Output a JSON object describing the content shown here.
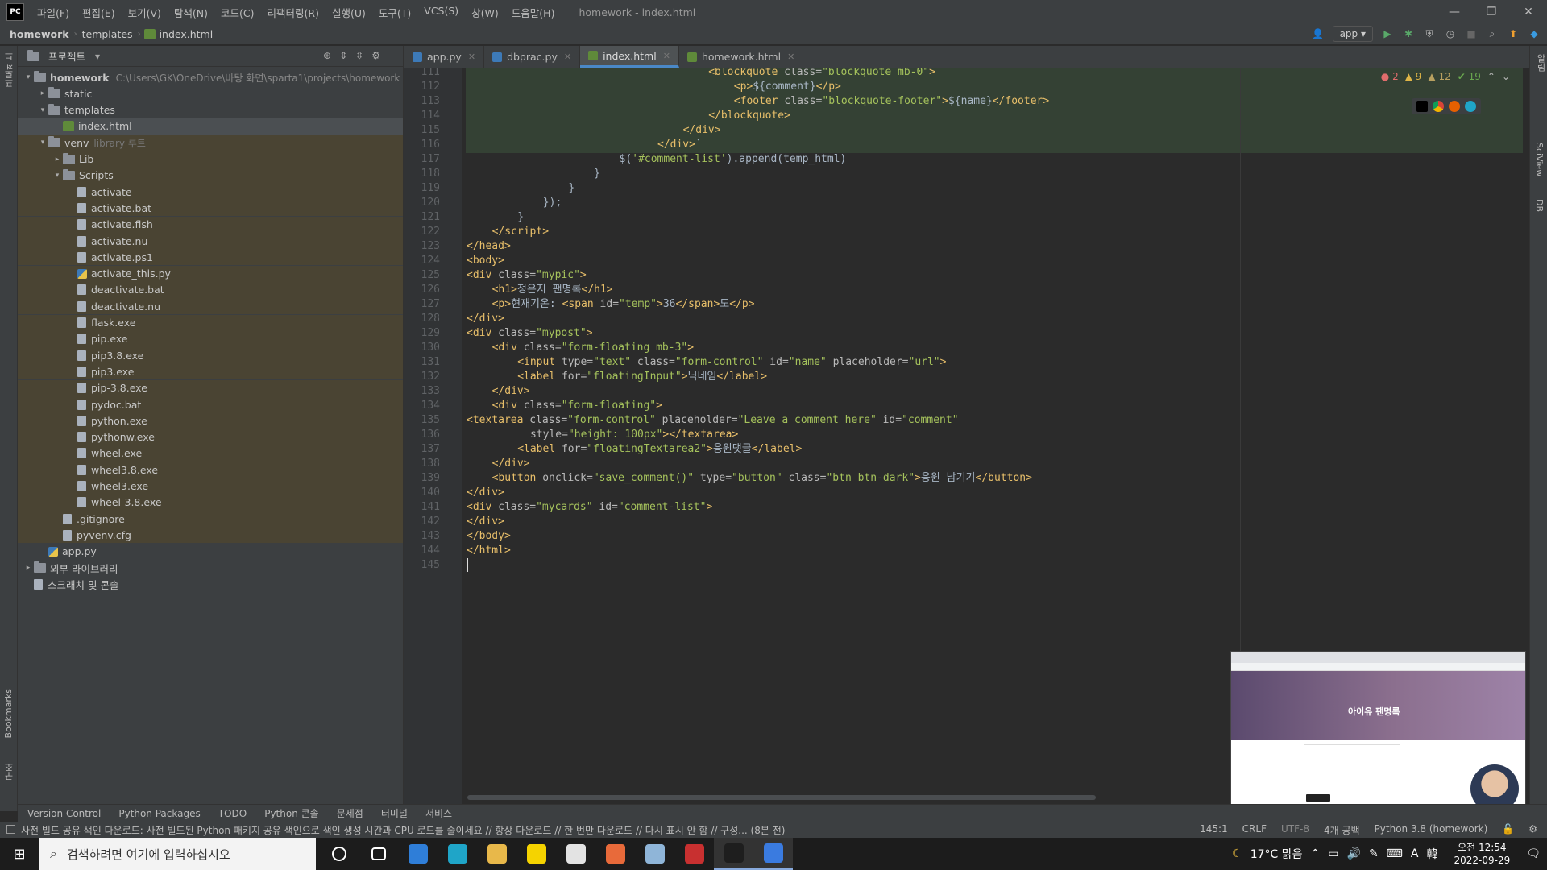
{
  "window": {
    "title": "homework - index.html",
    "logo": "PC",
    "menu": [
      "파일(F)",
      "편집(E)",
      "보기(V)",
      "탐색(N)",
      "코드(C)",
      "리팩터링(R)",
      "실행(U)",
      "도구(T)",
      "VCS(S)",
      "창(W)",
      "도움말(H)"
    ],
    "controls": [
      "—",
      "❐",
      "✕"
    ]
  },
  "breadcrumb": [
    "homework",
    "templates",
    "index.html"
  ],
  "run_config": "app",
  "project_panel": {
    "title": "프로젝트",
    "tree": [
      {
        "label": "homework",
        "hint": "C:\\Users\\GK\\OneDrive\\바탕 화면\\sparta1\\projects\\homework",
        "level": 0,
        "type": "folder",
        "open": true
      },
      {
        "label": "static",
        "level": 1,
        "type": "folder"
      },
      {
        "label": "templates",
        "level": 1,
        "type": "folder",
        "open": true
      },
      {
        "label": "index.html",
        "level": 2,
        "type": "html",
        "selected": true
      },
      {
        "label": "venv",
        "hint": "library 루트",
        "level": 1,
        "type": "folder",
        "open": true,
        "venv": true
      },
      {
        "label": "Lib",
        "level": 2,
        "type": "folder",
        "venv": true
      },
      {
        "label": "Scripts",
        "level": 2,
        "type": "folder",
        "open": true,
        "venv": true
      },
      {
        "label": "activate",
        "level": 3,
        "type": "file",
        "venv": true
      },
      {
        "label": "activate.bat",
        "level": 3,
        "type": "file",
        "venv": true
      },
      {
        "label": "activate.fish",
        "level": 3,
        "type": "file",
        "venv": true
      },
      {
        "label": "activate.nu",
        "level": 3,
        "type": "file",
        "venv": true
      },
      {
        "label": "activate.ps1",
        "level": 3,
        "type": "file",
        "venv": true
      },
      {
        "label": "activate_this.py",
        "level": 3,
        "type": "py",
        "venv": true
      },
      {
        "label": "deactivate.bat",
        "level": 3,
        "type": "file",
        "venv": true
      },
      {
        "label": "deactivate.nu",
        "level": 3,
        "type": "file",
        "venv": true
      },
      {
        "label": "flask.exe",
        "level": 3,
        "type": "file",
        "venv": true
      },
      {
        "label": "pip.exe",
        "level": 3,
        "type": "file",
        "venv": true
      },
      {
        "label": "pip3.8.exe",
        "level": 3,
        "type": "file",
        "venv": true
      },
      {
        "label": "pip3.exe",
        "level": 3,
        "type": "file",
        "venv": true
      },
      {
        "label": "pip-3.8.exe",
        "level": 3,
        "type": "file",
        "venv": true
      },
      {
        "label": "pydoc.bat",
        "level": 3,
        "type": "file",
        "venv": true
      },
      {
        "label": "python.exe",
        "level": 3,
        "type": "file",
        "venv": true
      },
      {
        "label": "pythonw.exe",
        "level": 3,
        "type": "file",
        "venv": true
      },
      {
        "label": "wheel.exe",
        "level": 3,
        "type": "file",
        "venv": true
      },
      {
        "label": "wheel3.8.exe",
        "level": 3,
        "type": "file",
        "venv": true
      },
      {
        "label": "wheel3.exe",
        "level": 3,
        "type": "file",
        "venv": true
      },
      {
        "label": "wheel-3.8.exe",
        "level": 3,
        "type": "file",
        "venv": true
      },
      {
        "label": ".gitignore",
        "level": 2,
        "type": "file",
        "venv": true
      },
      {
        "label": "pyvenv.cfg",
        "level": 2,
        "type": "file",
        "venv": true
      },
      {
        "label": "app.py",
        "level": 1,
        "type": "py"
      },
      {
        "label": "외부 라이브러리",
        "level": 0,
        "type": "folder"
      },
      {
        "label": "스크래치 및 콘솔",
        "level": 0,
        "type": "file"
      }
    ]
  },
  "tabs": [
    {
      "label": "app.py",
      "color": "#3d7ab8"
    },
    {
      "label": "dbprac.py",
      "color": "#3d7ab8"
    },
    {
      "label": "index.html",
      "color": "#5f8a3a",
      "active": true
    },
    {
      "label": "homework.html",
      "color": "#5f8a3a"
    }
  ],
  "inspections": {
    "errors": "2",
    "warnings": "9",
    "weak": "12",
    "ok": "19"
  },
  "code_lines": [
    {
      "n": "111",
      "indent": 38,
      "html": "<span class='tag'>&lt;blockquote </span><span class='attr'>class=</span><span class='str'>\"blockquote mb-0\"</span><span class='tag'>&gt;</span>"
    },
    {
      "n": "112",
      "indent": 42,
      "html": "<span class='tag'>&lt;p&gt;</span>${comment}<span class='tag'>&lt;/p&gt;</span>"
    },
    {
      "n": "113",
      "indent": 42,
      "html": "<span class='tag'>&lt;footer </span><span class='attr'>class=</span><span class='str'>\"blockquote-footer\"</span><span class='tag'>&gt;</span>${name}<span class='tag'>&lt;/footer&gt;</span>"
    },
    {
      "n": "114",
      "indent": 38,
      "html": "<span class='tag'>&lt;/blockquote&gt;</span>"
    },
    {
      "n": "115",
      "indent": 34,
      "html": "<span class='tag'>&lt;/div&gt;</span>"
    },
    {
      "n": "116",
      "indent": 30,
      "html": "<span class='tag'>&lt;/div&gt;</span>`"
    },
    {
      "n": "117",
      "indent": 24,
      "html": "$(<span class='str'>'#comment-list'</span>).append(temp_html)"
    },
    {
      "n": "118",
      "indent": 20,
      "html": "}"
    },
    {
      "n": "119",
      "indent": 16,
      "html": "}"
    },
    {
      "n": "120",
      "indent": 12,
      "html": "});"
    },
    {
      "n": "121",
      "indent": 8,
      "html": "}"
    },
    {
      "n": "122",
      "indent": 4,
      "html": "<span class='tag'>&lt;/script&gt;</span>"
    },
    {
      "n": "123",
      "indent": 0,
      "html": "<span class='tag'>&lt;/head&gt;</span>"
    },
    {
      "n": "124",
      "indent": 0,
      "html": "<span class='tag'>&lt;body&gt;</span>"
    },
    {
      "n": "125",
      "indent": 0,
      "html": "<span class='tag'>&lt;div </span><span class='attr'>class=</span><span class='str'>\"mypic\"</span><span class='tag'>&gt;</span>"
    },
    {
      "n": "126",
      "indent": 4,
      "html": "<span class='tag'>&lt;h1&gt;</span>정은지 팬명록<span class='tag'>&lt;/h1&gt;</span>"
    },
    {
      "n": "127",
      "indent": 4,
      "html": "<span class='tag'>&lt;p&gt;</span>현재기온: <span class='tag'>&lt;span </span><span class='attr'>id=</span><span class='str'>\"temp\"</span><span class='tag'>&gt;</span>36<span class='tag'>&lt;/span&gt;</span>도<span class='tag'>&lt;/p&gt;</span>"
    },
    {
      "n": "128",
      "indent": 0,
      "html": "<span class='tag'>&lt;/div&gt;</span>"
    },
    {
      "n": "129",
      "indent": 0,
      "html": "<span class='tag'>&lt;div </span><span class='attr'>class=</span><span class='str'>\"mypost\"</span><span class='tag'>&gt;</span>"
    },
    {
      "n": "130",
      "indent": 4,
      "html": "<span class='tag'>&lt;div </span><span class='attr'>class=</span><span class='str'>\"form-floating mb-3\"</span><span class='tag'>&gt;</span>"
    },
    {
      "n": "131",
      "indent": 8,
      "html": "<span class='tag'>&lt;input </span><span class='attr'>type=</span><span class='str'>\"text\"</span> <span class='attr'>class=</span><span class='str'>\"form-control\"</span> <span class='attr'>id=</span><span class='str'>\"name\"</span> <span class='attr'>placeholder=</span><span class='str'>\"url\"</span><span class='tag'>&gt;</span>"
    },
    {
      "n": "132",
      "indent": 8,
      "html": "<span class='tag'>&lt;label </span><span class='attr'>for=</span><span class='str'>\"floatingInput\"</span><span class='tag'>&gt;</span>닉네임<span class='tag'>&lt;/label&gt;</span>"
    },
    {
      "n": "133",
      "indent": 4,
      "html": "<span class='tag'>&lt;/div&gt;</span>"
    },
    {
      "n": "134",
      "indent": 4,
      "html": "<span class='tag'>&lt;div </span><span class='attr'>class=</span><span class='str'>\"form-floating\"</span><span class='tag'>&gt;</span>"
    },
    {
      "n": "135",
      "indent": 0,
      "html": "<span class='tag'>&lt;textarea </span><span class='attr'>class=</span><span class='str'>\"form-control\"</span> <span class='attr'>placeholder=</span><span class='str'>\"Leave a comment here\"</span> <span class='attr'>id=</span><span class='str'>\"comment\"</span>"
    },
    {
      "n": "136",
      "indent": 10,
      "html": "<span class='attr'>style=</span><span class='str'>\"height: 100px\"</span><span class='tag'>&gt;&lt;/textarea&gt;</span>"
    },
    {
      "n": "137",
      "indent": 8,
      "html": "<span class='tag'>&lt;label </span><span class='attr'>for=</span><span class='str'>\"floatingTextarea2\"</span><span class='tag'>&gt;</span>응원댓글<span class='tag'>&lt;/label&gt;</span>"
    },
    {
      "n": "138",
      "indent": 4,
      "html": "<span class='tag'>&lt;/div&gt;</span>"
    },
    {
      "n": "139",
      "indent": 4,
      "html": "<span class='tag'>&lt;button </span><span class='attr'>onclick=</span><span class='str'>\"save_comment()\"</span> <span class='attr'>type=</span><span class='str'>\"button\"</span> <span class='attr'>class=</span><span class='str'>\"btn btn-dark\"</span><span class='tag'>&gt;</span>응원 남기기<span class='tag'>&lt;/button&gt;</span>"
    },
    {
      "n": "140",
      "indent": 0,
      "html": "<span class='tag'>&lt;/div&gt;</span>"
    },
    {
      "n": "141",
      "indent": 0,
      "html": "<span class='tag'>&lt;div </span><span class='attr'>class=</span><span class='str'>\"mycards\"</span> <span class='attr'>id=</span><span class='str'>\"comment-list\"</span><span class='tag'>&gt;</span>"
    },
    {
      "n": "142",
      "indent": 0,
      "html": "<span class='tag'>&lt;/div&gt;</span>"
    },
    {
      "n": "143",
      "indent": 0,
      "html": "<span class='tag'>&lt;/body&gt;</span>"
    },
    {
      "n": "144",
      "indent": 0,
      "html": "<span class='tag'>&lt;/html&gt;</span>"
    },
    {
      "n": "145",
      "indent": 0,
      "html": "<span class='cursor'></span>"
    }
  ],
  "preview": {
    "title": "아이유 팬명록"
  },
  "tool_windows": [
    "Version Control",
    "Python Packages",
    "TODO",
    "Python 콘솔",
    "문제점",
    "터미널",
    "서비스"
  ],
  "status": {
    "message": "사전 빌드 공유 색인 다운로드: 사전 빌드된 Python 패키지 공유 색인으로 색인 생성 시간과 CPU 로드를 줄이세요 // 항상 다운로드 // 한 번만 다운로드 // 다시 표시 안 함 // 구성... (8분 전)",
    "position": "145:1",
    "line_sep": "CRLF",
    "encoding": "UTF-8",
    "indent": "4개 공백",
    "interpreter": "Python 3.8 (homework)"
  },
  "taskbar": {
    "search_placeholder": "검색하려면 여기에 입력하십시오",
    "weather": "17°C 맑음",
    "time": "오전 12:54",
    "date": "2022-09-29",
    "lang": "A",
    "ime": "韓",
    "apps": [
      {
        "name": "cortana",
        "color": "#1c1c1c"
      },
      {
        "name": "task-view",
        "color": "#1c1c1c"
      },
      {
        "name": "ie",
        "color": "#2f7ed8"
      },
      {
        "name": "edge",
        "color": "#1fa5c8"
      },
      {
        "name": "explorer",
        "color": "#e8b84a"
      },
      {
        "name": "kakaotalk",
        "color": "#f5d300"
      },
      {
        "name": "chrome",
        "color": "#e3e3e3"
      },
      {
        "name": "git",
        "color": "#e86a3a"
      },
      {
        "name": "notes",
        "color": "#8fb5d8"
      },
      {
        "name": "filezilla",
        "color": "#c83030"
      },
      {
        "name": "pycharm",
        "color": "#1e1e1e",
        "active": true
      },
      {
        "name": "app-blue",
        "color": "#3a7be0",
        "active": true
      }
    ]
  }
}
